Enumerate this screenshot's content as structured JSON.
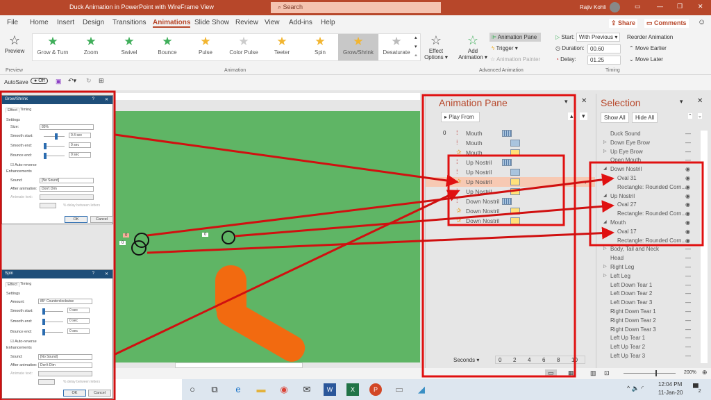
{
  "window": {
    "title": "Duck Animation in PowerPoint with WireFrame View",
    "search_placeholder": "Search",
    "user": "Rajiv Kohli"
  },
  "tabs": [
    "File",
    "Home",
    "Insert",
    "Design",
    "Transitions",
    "Animations",
    "Slide Show",
    "Review",
    "View",
    "Add-ins",
    "Help"
  ],
  "active_tab": "Animations",
  "share": "Share",
  "comments": "Comments",
  "ribbon": {
    "preview": "Preview",
    "preview_group": "Preview",
    "animation_group": "Animation",
    "effects": [
      {
        "label": "Grow & Turn",
        "color": "#3fae5a"
      },
      {
        "label": "Zoom",
        "color": "#3fae5a"
      },
      {
        "label": "Swivel",
        "color": "#3fae5a"
      },
      {
        "label": "Bounce",
        "color": "#3fae5a"
      },
      {
        "label": "Pulse",
        "color": "#f2b530"
      },
      {
        "label": "Color Pulse",
        "color": "#cccccc"
      },
      {
        "label": "Teeter",
        "color": "#f2b530"
      },
      {
        "label": "Spin",
        "color": "#f2b530"
      },
      {
        "label": "Grow/Shrink",
        "color": "#f2b530"
      },
      {
        "label": "Desaturate",
        "color": "#bbbbbb"
      }
    ],
    "selected_effect": "Grow/Shrink",
    "effect_options": "Effect Options",
    "add_animation": "Add Animation",
    "animation_pane": "Animation Pane",
    "trigger": "Trigger",
    "animation_painter": "Animation Painter",
    "advanced_group": "Advanced Animation",
    "start_label": "Start:",
    "start_value": "With Previous",
    "duration_label": "Duration:",
    "duration_value": "00.60",
    "delay_label": "Delay:",
    "delay_value": "01.25",
    "timing_group": "Timing",
    "reorder": "Reorder Animation",
    "move_earlier": "Move Earlier",
    "move_later": "Move Later"
  },
  "qat": {
    "autosave": "AutoSave",
    "autosave_state": "Off"
  },
  "dialog_grow": {
    "title": "Grow/Shrink",
    "tabs": [
      "Effect",
      "Timing"
    ],
    "settings": "Settings",
    "size_label": "Size:",
    "size": "85%",
    "smooth_start_label": "Smooth start:",
    "smooth_start": "0.4 sec",
    "smooth_end_label": "Smooth end:",
    "smooth_end": "0 sec",
    "bounce_end_label": "Bounce end:",
    "bounce_end": "0 sec",
    "auto_reverse": "Auto-reverse",
    "enhancements": "Enhancements",
    "sound_label": "Sound:",
    "sound": "[No Sound]",
    "after_label": "After animation:",
    "after": "Don't Dim",
    "animate_text_label": "Animate text:",
    "delay_letters": "% delay between letters",
    "ok": "OK",
    "cancel": "Cancel"
  },
  "dialog_spin": {
    "title": "Spin",
    "tabs": [
      "Effect",
      "Timing"
    ],
    "settings": "Settings",
    "amount_label": "Amount:",
    "amount": "85° Counterclockwise",
    "smooth_start_label": "Smooth start:",
    "smooth_start": "0 sec",
    "smooth_end_label": "Smooth end:",
    "smooth_end": "0 sec",
    "bounce_end_label": "Bounce end:",
    "bounce_end": "0 sec",
    "auto_reverse": "Auto-reverse",
    "enhancements": "Enhancements",
    "sound_label": "Sound:",
    "sound": "[No Sound]",
    "after_label": "After animation:",
    "after": "Don't Dim",
    "animate_text_label": "Animate text:",
    "delay_letters": "% delay between letters",
    "ok": "OK",
    "cancel": "Cancel"
  },
  "slide": {
    "tag_a": "0",
    "tag_b": "0",
    "tag_c": "0"
  },
  "animation_pane": {
    "title": "Animation Pane",
    "play_from": "Play From",
    "index": "0",
    "items": [
      {
        "label": "Mouth",
        "type": "path",
        "bar": "striped"
      },
      {
        "label": "Mouth",
        "type": "path",
        "bar": "blue"
      },
      {
        "label": "Mouth",
        "type": "star",
        "bar": "yellow"
      },
      {
        "label": "Up Nostril",
        "type": "path",
        "bar": "striped"
      },
      {
        "label": "Up Nostril",
        "type": "path",
        "bar": "blue"
      },
      {
        "label": "Up Nostril",
        "type": "star",
        "bar": "yellow",
        "selected": true
      },
      {
        "label": "Up Nostril",
        "type": "path",
        "bar": "yellow"
      },
      {
        "label": "Down Nostril",
        "type": "path",
        "bar": "striped"
      },
      {
        "label": "Down Nostril",
        "type": "star",
        "bar": "yellow"
      },
      {
        "label": "Down Nostril",
        "type": "star",
        "bar": "yellow"
      }
    ],
    "seconds": "Seconds",
    "ticks": [
      "0",
      "2",
      "4",
      "6",
      "8",
      "10"
    ]
  },
  "selection": {
    "title": "Selection",
    "show_all": "Show All",
    "hide_all": "Hide All",
    "items": [
      {
        "label": "Duck Sound",
        "indent": 0,
        "vis": "—"
      },
      {
        "label": "Down Eye Brow",
        "indent": 0,
        "exp": "▷",
        "vis": "—"
      },
      {
        "label": "Up Eye Brow",
        "indent": 0,
        "exp": "▷",
        "vis": "—"
      },
      {
        "label": "Open Mouth",
        "indent": 0,
        "vis": "—"
      },
      {
        "label": "Down Nostril",
        "indent": 0,
        "exp": "◢",
        "vis": "👁"
      },
      {
        "label": "Oval 31",
        "indent": 1,
        "vis": "👁"
      },
      {
        "label": "Rectangle: Rounded Corn...",
        "indent": 1,
        "vis": "👁"
      },
      {
        "label": "Up Nostril",
        "indent": 0,
        "exp": "◢",
        "vis": "👁"
      },
      {
        "label": "Oval 27",
        "indent": 1,
        "vis": "👁"
      },
      {
        "label": "Rectangle: Rounded Corn...",
        "indent": 1,
        "vis": "👁"
      },
      {
        "label": "Mouth",
        "indent": 0,
        "exp": "◢",
        "vis": "👁"
      },
      {
        "label": "Oval 17",
        "indent": 1,
        "vis": "👁"
      },
      {
        "label": "Rectangle: Rounded Corn...",
        "indent": 1,
        "vis": "👁"
      },
      {
        "label": "Body, Tail and Neck",
        "indent": 0,
        "exp": "▷",
        "vis": "—"
      },
      {
        "label": "Head",
        "indent": 0,
        "vis": "—"
      },
      {
        "label": "Right Leg",
        "indent": 0,
        "exp": "▷",
        "vis": "—"
      },
      {
        "label": "Left Leg",
        "indent": 0,
        "exp": "▷",
        "vis": "—"
      },
      {
        "label": "Left Down Tear 1",
        "indent": 0,
        "vis": "—"
      },
      {
        "label": "Left Down Tear 2",
        "indent": 0,
        "vis": "—"
      },
      {
        "label": "Left Down Tear 3",
        "indent": 0,
        "vis": "—"
      },
      {
        "label": "Right Down Tear 1",
        "indent": 0,
        "vis": "—"
      },
      {
        "label": "Right Down Tear 2",
        "indent": 0,
        "vis": "—"
      },
      {
        "label": "Right Down Tear 3",
        "indent": 0,
        "vis": "—"
      },
      {
        "label": "Left Up Tear 1",
        "indent": 0,
        "vis": "—"
      },
      {
        "label": "Left Up Tear 2",
        "indent": 0,
        "vis": "—"
      },
      {
        "label": "Left Up Tear 3",
        "indent": 0,
        "vis": "—"
      }
    ]
  },
  "status": {
    "zoom": "200%"
  },
  "taskbar": {
    "time": "12:04 PM",
    "date": "11-Jan-20",
    "notifications": "2"
  },
  "colors": {
    "accent": "#b7472a",
    "slide": "#5fb565",
    "duck": "#f26a10",
    "annotation": "#e01010"
  }
}
